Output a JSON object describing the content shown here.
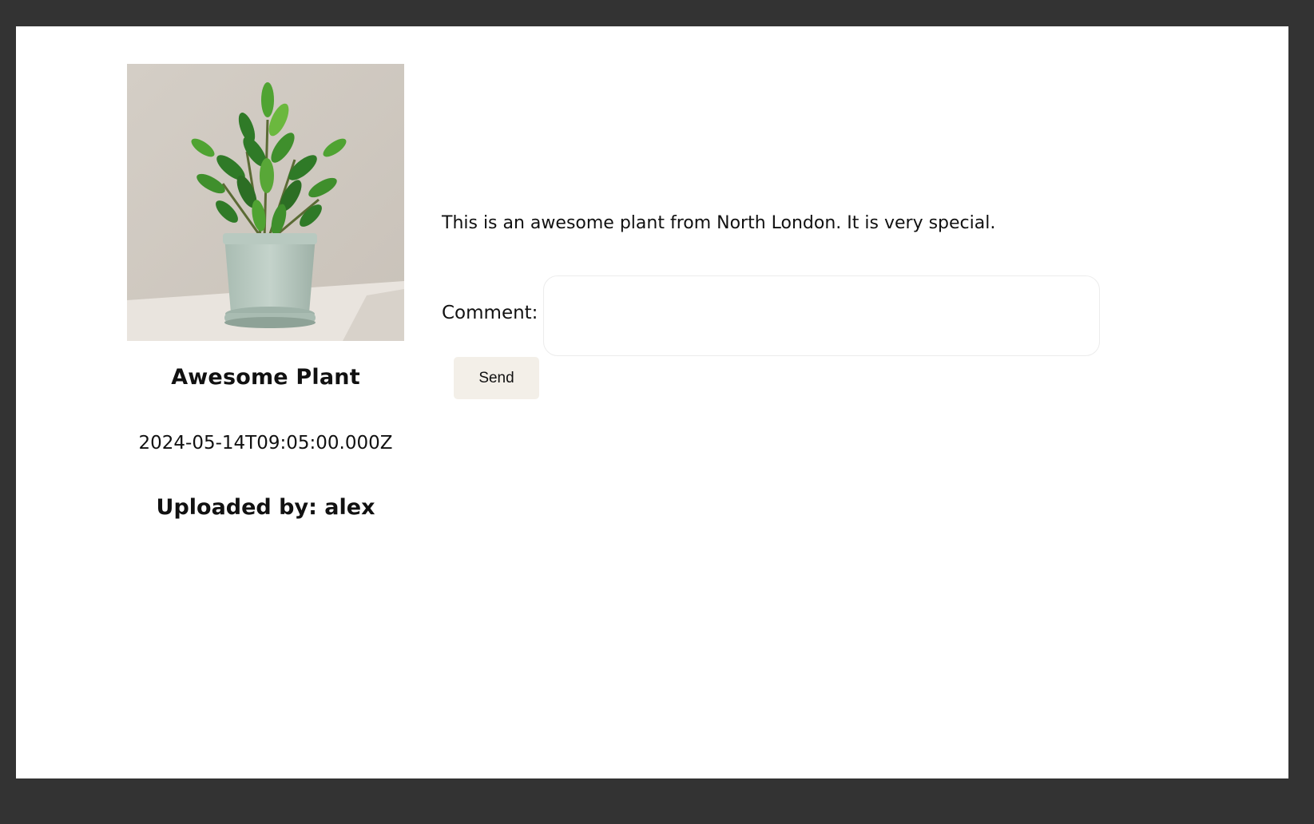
{
  "post": {
    "title": "Awesome Plant",
    "date": "2024-05-14T09:05:00.000Z",
    "uploaded_by": "Uploaded by: alex",
    "description": "This is an awesome plant from North London. It is very special."
  },
  "comment_form": {
    "label": "Comment:",
    "value": "",
    "placeholder": "",
    "send_label": "Send"
  },
  "colors": {
    "backdrop": "#333333",
    "page": "#ffffff",
    "button_bg": "#f3efe8",
    "input_border": "#ececec"
  },
  "icons": {
    "photo": "potted-plant-photo"
  }
}
